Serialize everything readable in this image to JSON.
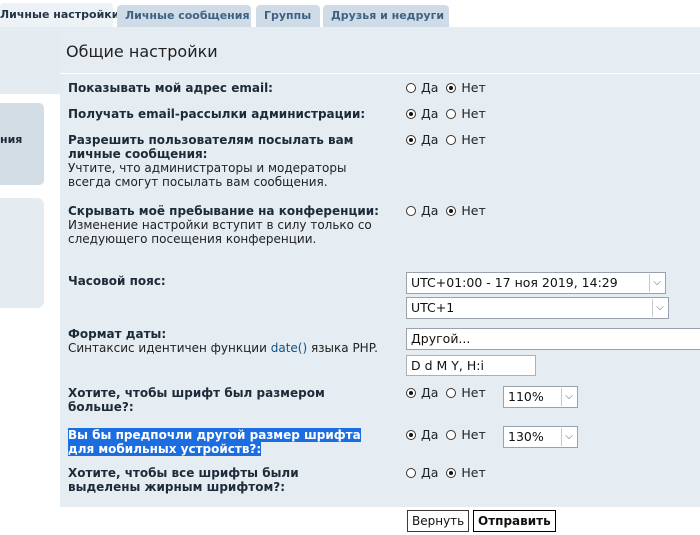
{
  "tabs": [
    {
      "label": "Личные настройки",
      "active": true
    },
    {
      "label": "Личные сообщения",
      "active": false
    },
    {
      "label": "Группы",
      "active": false
    },
    {
      "label": "Друзья и недруги",
      "active": false
    }
  ],
  "sidebar": {
    "menu_fragment": "ния"
  },
  "panel": {
    "title": "Общие настройки"
  },
  "options": {
    "yes": "Да",
    "no": "Нет"
  },
  "settings": {
    "show_email": {
      "label": "Показывать мой адрес email:",
      "value": "Нет"
    },
    "admin_mail": {
      "label": "Получать email-рассылки администрации:",
      "value": "Да"
    },
    "allow_pm": {
      "label": "Разрешить пользователям посылать вам личные сообщения:",
      "desc": "Учтите, что администраторы и модераторы всегда смогут посылать вам сообщения.",
      "value": "Да"
    },
    "hide_online": {
      "label": "Скрывать моё пребывание на конференции:",
      "desc": "Изменение настройки вступит в силу только со следующего посещения конференции.",
      "value": "Нет"
    },
    "timezone": {
      "label": "Часовой пояс:",
      "date_select": "UTC+01:00 - 17 ноя 2019, 14:29",
      "zone_select": "UTC+1"
    },
    "date_format": {
      "label": "Формат даты:",
      "desc_before": "Синтаксис идентичен функции ",
      "desc_link": "date()",
      "desc_after": " языка PHP.",
      "select": "Другой...",
      "input_value": "D d M Y, H:i"
    },
    "bigger_font": {
      "label": "Хотите, чтобы шрифт был размером больше?:",
      "value": "Да",
      "size": "110%"
    },
    "mobile_font": {
      "label": "Вы бы предпочли другой размер шрифта для мобильных устройств?:",
      "value": "Да",
      "size": "130%"
    },
    "bold_fonts": {
      "label": "Хотите, чтобы все шрифты были выделены жирным шрифтом?:",
      "value": "Нет"
    }
  },
  "buttons": {
    "reset": "Вернуть",
    "submit": "Отправить"
  }
}
